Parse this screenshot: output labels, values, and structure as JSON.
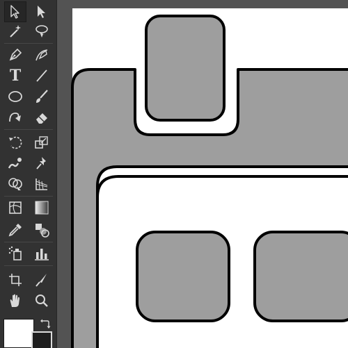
{
  "toolbar": {
    "tools": [
      {
        "row": 1,
        "left": "selection-tool",
        "right": "direct-selection-tool"
      },
      {
        "row": 2,
        "left": "magic-wand-tool",
        "right": "lasso-tool"
      },
      {
        "row": 3,
        "left": "pen-tool",
        "right": "curvature-tool"
      },
      {
        "row": 4,
        "left": "type-tool",
        "right": "line-segment-tool"
      },
      {
        "row": 5,
        "left": "ellipse-tool",
        "right": "paintbrush-tool"
      },
      {
        "row": 6,
        "left": "shaper-tool",
        "right": "eraser-tool"
      },
      {
        "row": 7,
        "left": "rotate-tool",
        "right": "scale-tool"
      },
      {
        "row": 8,
        "left": "warp-tool",
        "right": "puppet-warp-tool"
      },
      {
        "row": 9,
        "left": "shape-builder-tool",
        "right": "perspective-grid-tool"
      },
      {
        "row": 10,
        "left": "mesh-tool",
        "right": "gradient-tool"
      },
      {
        "row": 11,
        "left": "eyedropper-tool",
        "right": "blend-tool"
      },
      {
        "row": 12,
        "left": "symbol-sprayer-tool",
        "right": "column-graph-tool"
      },
      {
        "row": 13,
        "left": "artboard-tool",
        "right": "slice-tool"
      },
      {
        "row": 14,
        "left": "hand-tool",
        "right": "zoom-tool"
      }
    ],
    "selected_tool": "selection-tool",
    "type_tool_glyph": "T"
  },
  "canvas": {
    "artboard_color": "#ffffff",
    "shape_fill": "#9e9e9e",
    "shape_stroke": "#000000",
    "pasteboard_color": "#535353"
  },
  "swatches": {
    "fill": "#ffffff",
    "stroke": "#1e1e1e"
  }
}
